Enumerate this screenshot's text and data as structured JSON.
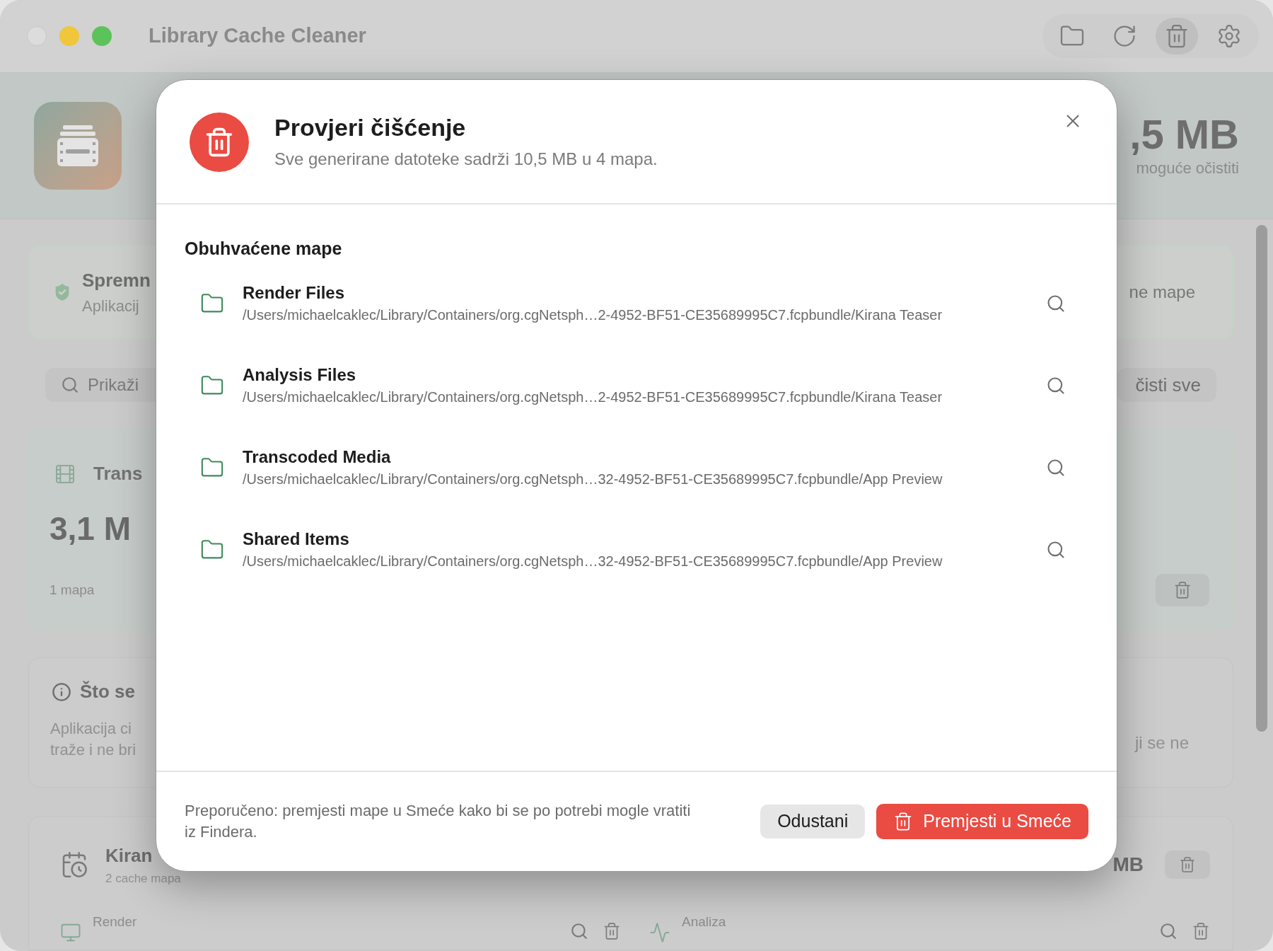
{
  "window": {
    "title": "Library Cache Cleaner",
    "toolbar": [
      {
        "kind": "folder",
        "selected": false
      },
      {
        "kind": "refresh",
        "selected": false
      },
      {
        "kind": "trash",
        "selected": true
      },
      {
        "kind": "settings",
        "selected": false
      }
    ]
  },
  "background": {
    "header": {
      "total": ",5 MB",
      "caption": "moguće očistiti"
    },
    "status_card": {
      "title": "Spremn",
      "text": "Aplikacij",
      "action": "ne mape"
    },
    "search": {
      "placeholder": "Prikaži"
    },
    "clear_all": "čisti sve",
    "category_card": {
      "name": "Trans",
      "size": "3,1 M",
      "count": "1 mapa"
    },
    "info_card": {
      "title": "Što se",
      "lines": [
        "Aplikacija ci",
        "traže i ne bri"
      ],
      "text_right": "ji se ne"
    },
    "project": {
      "name": "Kiran",
      "subtitle": "2 cache mapa",
      "size": "MB",
      "items": [
        {
          "kind": "render",
          "label": "Render"
        },
        {
          "kind": "analysis",
          "label": "Analiza"
        }
      ]
    }
  },
  "dialog": {
    "title": "Provjeri čišćenje",
    "subtitle": "Sve generirane datoteke sadrži 10,5 MB u 4 mapa.",
    "section_title": "Obuhvaćene mape",
    "folders": [
      {
        "name": "Render Files",
        "path": "/Users/michaelcaklec/Library/Containers/org.cgNetsph…2-4952-BF51-CE35689995C7.fcpbundle/Kirana Teaser"
      },
      {
        "name": "Analysis Files",
        "path": "/Users/michaelcaklec/Library/Containers/org.cgNetsph…2-4952-BF51-CE35689995C7.fcpbundle/Kirana Teaser"
      },
      {
        "name": "Transcoded Media",
        "path": "/Users/michaelcaklec/Library/Containers/org.cgNetsph…32-4952-BF51-CE35689995C7.fcpbundle/App Preview"
      },
      {
        "name": "Shared Items",
        "path": "/Users/michaelcaklec/Library/Containers/org.cgNetsph…32-4952-BF51-CE35689995C7.fcpbundle/App Preview"
      }
    ],
    "note": "Preporučeno: premjesti mape u Smeće kako bi se po potrebi mogle vratiti iz Findera.",
    "cancel": "Odustani",
    "confirm": "Premjesti u Smeće"
  }
}
